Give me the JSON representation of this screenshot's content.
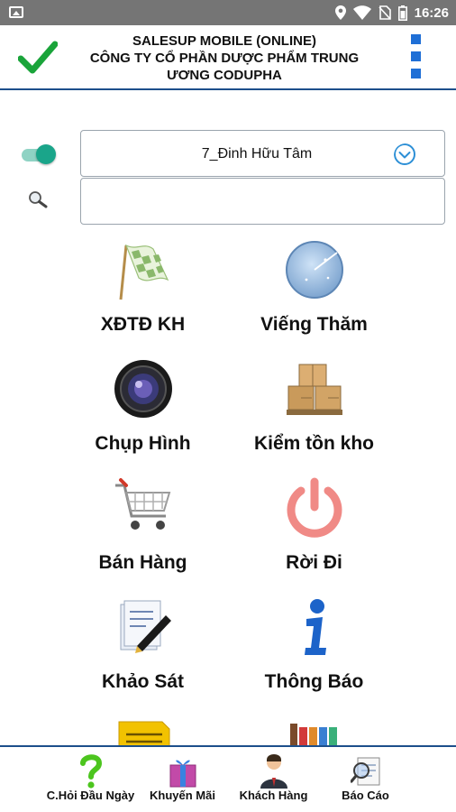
{
  "status_bar": {
    "time": "16:26"
  },
  "header": {
    "title_line1": "SALESUP MOBILE (ONLINE)",
    "title_line2": "CÔNG TY CỔ PHẦN DƯỢC PHẨM TRUNG",
    "title_line3": "ƯƠNG CODUPHA",
    "accent_color": "#1d4f8b"
  },
  "customer_selector": {
    "value": "7_Đinh Hữu Tâm"
  },
  "search": {
    "value": "",
    "placeholder": ""
  },
  "tiles": [
    {
      "label": "XĐTĐ KH",
      "icon": "checkered-flag-icon"
    },
    {
      "label": "Viếng Thăm",
      "icon": "radar-icon"
    },
    {
      "label": "Chụp Hình",
      "icon": "camera-lens-icon"
    },
    {
      "label": "Kiểm tồn kho",
      "icon": "boxes-icon"
    },
    {
      "label": "Bán Hàng",
      "icon": "shopping-cart-icon"
    },
    {
      "label": "Rời Đi",
      "icon": "power-icon"
    },
    {
      "label": "Khảo Sát",
      "icon": "survey-pen-icon"
    },
    {
      "label": "Thông Báo",
      "icon": "info-icon"
    },
    {
      "label": "",
      "icon": "notepad-icon"
    },
    {
      "label": "",
      "icon": "books-icon"
    }
  ],
  "bottom_nav": [
    {
      "label": "C.Hỏi Đầu Ngày",
      "icon": "question-icon"
    },
    {
      "label": "Khuyến Mãi",
      "icon": "gift-icon"
    },
    {
      "label": "Khách Hàng",
      "icon": "customer-icon"
    },
    {
      "label": "Báo Cáo",
      "icon": "report-icon"
    }
  ]
}
